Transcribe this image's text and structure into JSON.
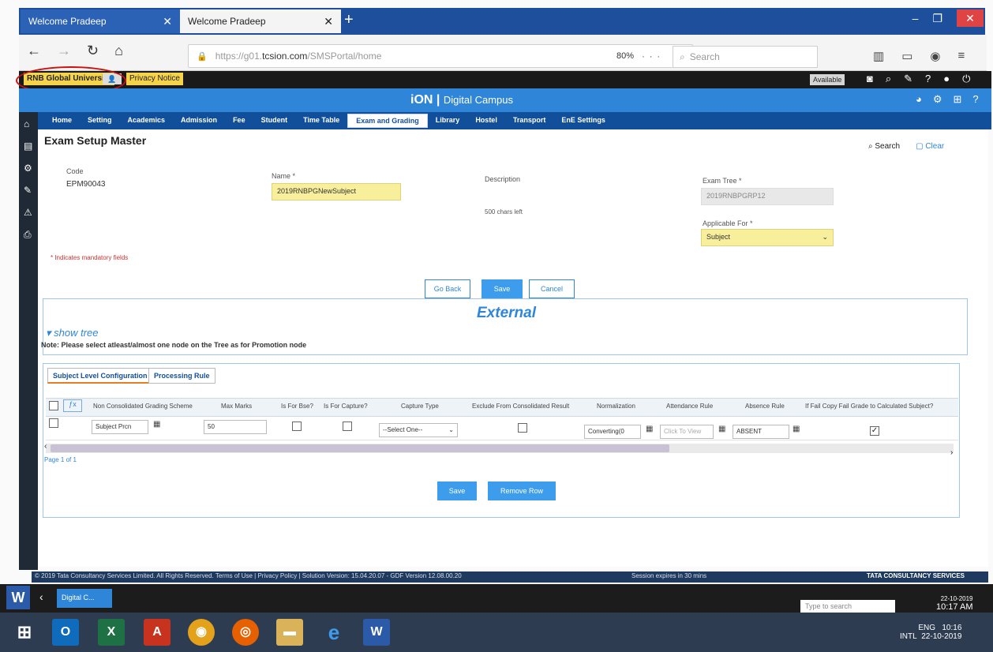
{
  "browser": {
    "tabs": [
      {
        "label": "Welcome Pradeep"
      },
      {
        "label": "Welcome Pradeep"
      }
    ],
    "url_host": "tcsion.com",
    "url_prefix": "https://g01.",
    "url_path": "/SMSPortal/home",
    "zoom": "80%",
    "search_placeholder": "Search"
  },
  "header": {
    "university": "RNB Global University",
    "privacy": "Privacy Notice",
    "status": "Available",
    "brand": "iON",
    "brand_sub": "Digital Campus"
  },
  "menu": [
    "Home",
    "Setting",
    "Academics",
    "Admission",
    "Fee",
    "Student",
    "Time Table",
    "Exam and Grading",
    "Library",
    "Hostel",
    "Transport",
    "EnE Settings"
  ],
  "page": {
    "title": "Exam Setup Master",
    "search": "Search",
    "clear": "Clear",
    "code_label": "Code",
    "code_value": "EPM90043",
    "name_label": "Name *",
    "name_value": "2019RNBPGNewSubject",
    "desc_label": "Description",
    "chars_left": "500 chars left",
    "exam_tree_label": "Exam Tree *",
    "exam_tree_value": "2019RNBPGRP12",
    "applicable_label": "Applicable For *",
    "applicable_value": "Subject",
    "mandatory_note": "* Indicates mandatory fields",
    "btn_goback": "Go Back",
    "btn_save": "Save",
    "btn_cancel": "Cancel"
  },
  "external": {
    "title": "External",
    "show_tree": "show tree",
    "note": "Note: Please select atleast/almost one node on the Tree as for Promotion node"
  },
  "config": {
    "tabs": [
      "Subject Level Configuration",
      "Processing Rule"
    ],
    "headers": [
      "Non Consolidated Grading Scheme",
      "Max Marks",
      "Is For Bse?",
      "Is For Capture?",
      "Capture Type",
      "Exclude From Consolidated Result",
      "Normalization",
      "Attendance Rule",
      "Absence Rule",
      "If Fail Copy Fail Grade to Calculated Subject?"
    ],
    "row": {
      "grading": "Subject Prcn",
      "max_marks": "50",
      "capture_type": "--Select One--",
      "normalization": "Converting(0",
      "attendance": "Click To View",
      "absence": "ABSENT"
    },
    "page_of": "Page 1 of 1",
    "btn_save": "Save",
    "btn_remove": "Remove Row"
  },
  "footer": {
    "copyright": "© 2019 Tata Consultancy Services Limited. All Rights Reserved.  Terms of Use | Privacy Policy | Solution Version: 15.04.20.07 - GDF Version 12.08.00.20",
    "session": "Session expires in 30 mins",
    "tata": "TATA CONSULTANCY SERVICES"
  },
  "taskbar": {
    "app_tab": "Digital C...",
    "search": "Type to search",
    "date1": "22-10-2019",
    "time1": "10:17 AM",
    "lang": "ENG",
    "region": "INTL",
    "time2": "10:16",
    "date2": "22-10-2019"
  }
}
